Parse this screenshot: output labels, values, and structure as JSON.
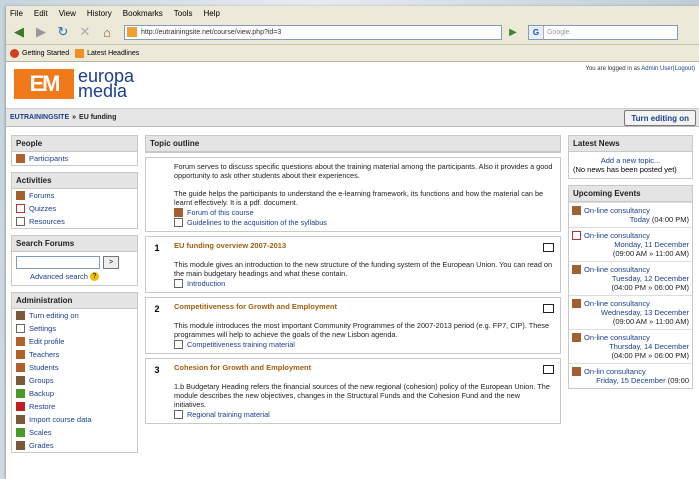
{
  "browser": {
    "menu": [
      "File",
      "Edit",
      "View",
      "History",
      "Bookmarks",
      "Tools",
      "Help"
    ],
    "url": "http://eutrainingsite.net/course/view.php?id=3",
    "search_placeholder": "Google",
    "bookmarks": [
      "Getting Started",
      "Latest Headlines"
    ]
  },
  "header": {
    "logo_mark": "EM",
    "logo_line1": "europa",
    "logo_line2": "media",
    "logged_prefix": "You are logged in as",
    "logged_user": "Admin User",
    "logout": "(Logout)"
  },
  "crumb": {
    "site": "EUTRAININGSITE",
    "sep": "»",
    "course": "EU funding",
    "edit_button": "Turn editing on"
  },
  "left": {
    "people_title": "People",
    "participants": "Participants",
    "activities_title": "Activities",
    "activities": [
      "Forums",
      "Quizzes",
      "Resources"
    ],
    "search_title": "Search Forums",
    "search_go": ">",
    "advanced": "Advanced search",
    "admin_title": "Administration",
    "admin_items": [
      "Turn editing on",
      "Settings",
      "Edit profile",
      "Teachers",
      "Students",
      "Groups",
      "Backup",
      "Restore",
      "Import course data",
      "Scales",
      "Grades"
    ]
  },
  "main": {
    "title": "Topic outline",
    "intro_p1": "Forum serves to discuss specific questions about the training material among the participants. Also it provides a good opportunity to ask other students about their experiences.",
    "intro_p2": "The guide helps the participants to understand the e-learning framework, its functions and how the material can be learnt effectively. It is a pdf. document.",
    "intro_link1": "Forum of this course",
    "intro_link2": "Guidelines to the acquisition of the syllabus",
    "sections": [
      {
        "num": "1",
        "title": "EU funding overview 2007-2013",
        "text": "This module gives an introduction to the new structure of the funding system of the European Union. You can read on the main budgetary headings and what these contain.",
        "link": "Introduction"
      },
      {
        "num": "2",
        "title": "Competitiveness for Growth and Employment",
        "text": "This module introduces the most important Community Programmes of the 2007-2013 period (e.g. FP7, CIP). These programmes will help to achieve the goals of the new Lisbon agenda.",
        "link": "Competitiveness training material"
      },
      {
        "num": "3",
        "title": "Cohesion for Growth and Employment",
        "text": "1.b Budgetary Heading refers the financial sources of the new regional (cohesion) policy of the European Union. The module describes the new objectives, changes in the Structural Funds and the Cohesion Fund and the new initiatives.",
        "link": "Regional training material"
      }
    ]
  },
  "right": {
    "news_title": "Latest News",
    "news_add": "Add a new topic...",
    "news_none": "(No news has been posted yet)",
    "events_title": "Upcoming Events",
    "events": [
      {
        "name": "On-line consultancy",
        "date": "Today",
        "time": "(04:00 PM)"
      },
      {
        "name": "On-line consultancy",
        "date": "Monday, 11 December",
        "time": "(09:00 AM » 11:00 AM)"
      },
      {
        "name": "On-line consultancy",
        "date": "Tuesday, 12 December",
        "time": "(04:00 PM » 06:00 PM)"
      },
      {
        "name": "On-line consultancy",
        "date": "Wednesday, 13 December",
        "time": "(09:00 AM » 11:00 AM)"
      },
      {
        "name": "On-line consultancy",
        "date": "Thursday, 14 December",
        "time": "(04:00 PM » 06:00 PM)"
      },
      {
        "name": "On-lin consultancy",
        "date": "Friday, 15 December",
        "time": "(09:00"
      }
    ]
  }
}
